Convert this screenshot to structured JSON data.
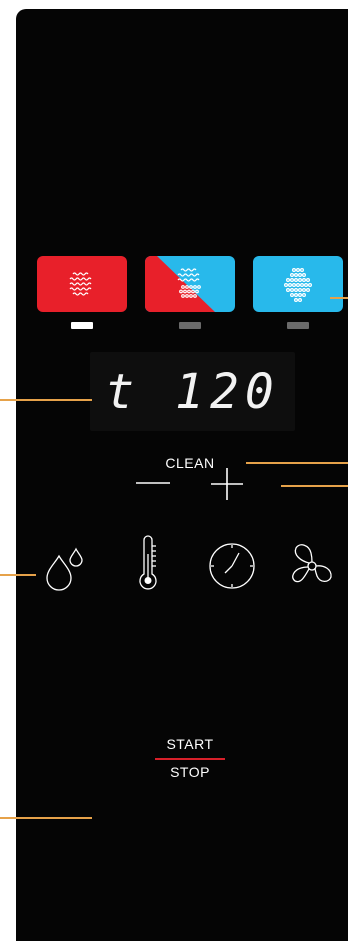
{
  "display": {
    "text": "t 120"
  },
  "modes": [
    {
      "id": "convection",
      "color": "#e8202a",
      "active": true
    },
    {
      "id": "combi",
      "color": "#e8202a",
      "color2": "#28b9eb",
      "active": false
    },
    {
      "id": "steam",
      "color": "#28b9eb",
      "active": false
    }
  ],
  "colors": {
    "panel": "#050505",
    "callout": "#e6a24a",
    "indicator_active": "#ffffff",
    "indicator_inactive": "#6a6a6a",
    "underline": "#d8202a"
  },
  "adjust": {
    "minus_icon": "minus-icon",
    "plus_icon": "plus-icon"
  },
  "functions": [
    "humidity-icon",
    "thermometer-icon",
    "clock-icon",
    "fan-icon"
  ],
  "clean": {
    "label": "CLEAN"
  },
  "start_stop": {
    "start_label": "START",
    "stop_label": "STOP"
  }
}
